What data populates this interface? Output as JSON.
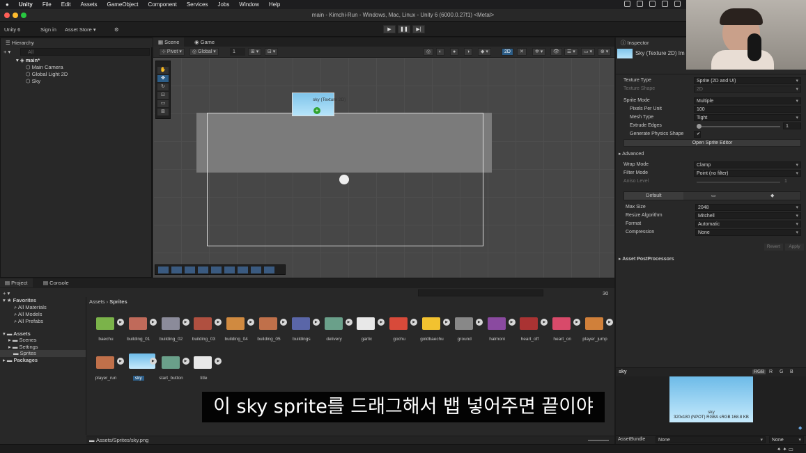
{
  "menubar": {
    "app": "Unity",
    "items": [
      "File",
      "Edit",
      "Assets",
      "GameObject",
      "Component",
      "Services",
      "Jobs",
      "Window",
      "Help"
    ]
  },
  "window": {
    "title": "main - Kimchi-Run - Windows, Mac, Linux - Unity 6 (6000.0.27f1) <Metal>"
  },
  "toolbar": {
    "account": "Unity 6",
    "sign_in": "Sign in",
    "asset_store": "Asset Store",
    "play_icon": "play-icon",
    "pause_icon": "pause-icon",
    "step_icon": "step-icon"
  },
  "hierarchy": {
    "tab": "Hierarchy",
    "search_placeholder": "All",
    "scene": "main*",
    "items": [
      "Main Camera",
      "Global Light 2D",
      "Sky"
    ]
  },
  "scene_view": {
    "tabs": [
      "Scene",
      "Game"
    ],
    "pivot": "Pivot",
    "global": "Global",
    "grid_value": "1",
    "mode_2d": "2D",
    "drag_label": "sky (Texture 2D)"
  },
  "inspector": {
    "tab": "Inspector",
    "header": "Sky (Texture 2D) Im",
    "fields": {
      "texture_type_label": "Texture Type",
      "texture_type": "Sprite (2D and UI)",
      "texture_shape_label": "Texture Shape",
      "texture_shape": "2D",
      "sprite_mode_label": "Sprite Mode",
      "sprite_mode": "Multiple",
      "ppu_label": "Pixels Per Unit",
      "ppu": "100",
      "mesh_type_label": "Mesh Type",
      "mesh_type": "Tight",
      "extrude_label": "Extrude Edges",
      "extrude": "1",
      "physics_label": "Generate Physics Shape",
      "physics": "✔",
      "open_editor": "Open Sprite Editor",
      "advanced": "Advanced",
      "wrap_label": "Wrap Mode",
      "wrap": "Clamp",
      "filter_label": "Filter Mode",
      "filter": "Point (no filter)",
      "aniso_label": "Aniso Level",
      "aniso": "1",
      "platform_default": "Default",
      "max_size_label": "Max Size",
      "max_size": "2048",
      "resize_label": "Resize Algorithm",
      "resize": "Mitchell",
      "format_label": "Format",
      "format": "Automatic",
      "compression_label": "Compression",
      "compression": "None",
      "revert": "Revert",
      "apply": "Apply",
      "postprocessors": "Asset PostProcessors"
    },
    "preview": {
      "name": "sky",
      "channels": [
        "RGB",
        "R",
        "G",
        "B"
      ],
      "caption_name": "sky",
      "caption_info": "320x180 (NPOT) RGBA sRGB 168.8 KB"
    },
    "assetbundle_label": "AssetBundle",
    "assetbundle_value": "None",
    "assetbundle_variant": "None"
  },
  "project": {
    "tabs": [
      "Project",
      "Console"
    ],
    "favorites_label": "Favorites",
    "favorites": [
      "All Materials",
      "All Models",
      "All Prefabs"
    ],
    "assets_label": "Assets",
    "folders": [
      "Scenes",
      "Settings",
      "Sprites"
    ],
    "packages_label": "Packages",
    "breadcrumb_root": "Assets",
    "breadcrumb_leaf": "Sprites",
    "count": "30",
    "assets_row1": [
      "baechu",
      "building_01",
      "building_02",
      "building_03",
      "building_04",
      "building_05",
      "buildings",
      "delivery",
      "garlic",
      "gochu",
      "goldbaechu",
      "ground",
      "halmoni",
      "heart_off",
      "heart_on",
      "player_jump"
    ],
    "assets_row2": [
      "player_run",
      "sky",
      "start_button",
      "title"
    ],
    "path": "Assets/Sprites/sky.png"
  },
  "subtitle": "이 sky sprite를 드래그해서 뱁 넣어주면 끝이야",
  "colors": {
    "accent_blue": "#2c5d87",
    "sky_blue": "#8fd0f0",
    "panel": "#282828"
  }
}
